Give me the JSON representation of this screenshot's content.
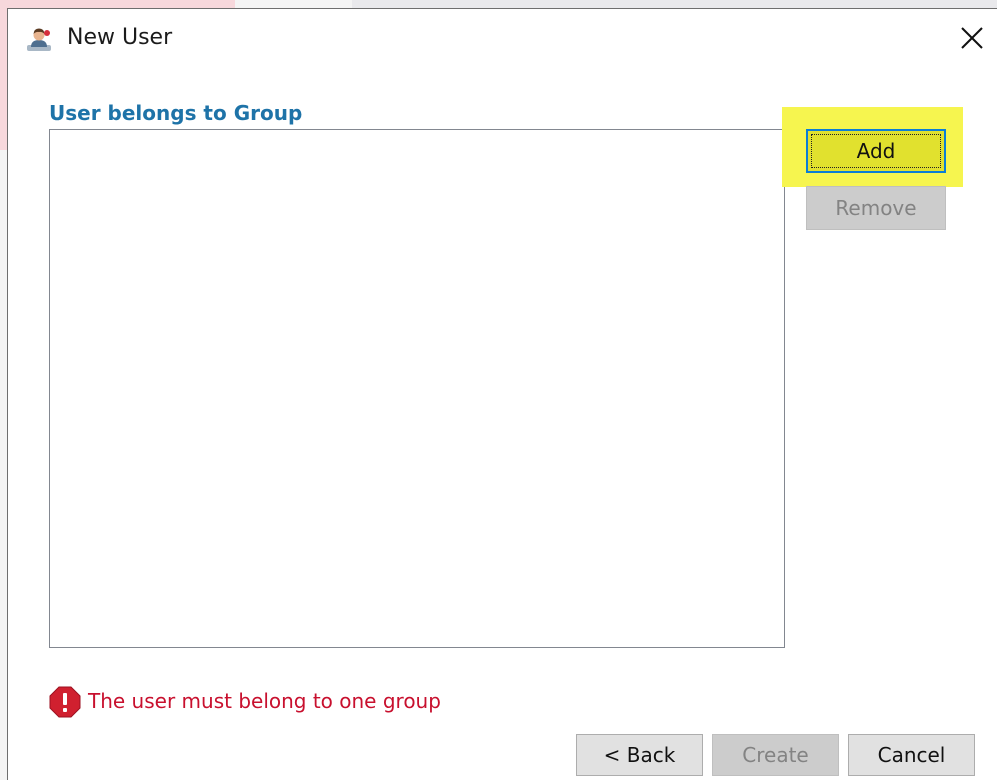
{
  "window": {
    "title": "New User",
    "icon": "user-icon"
  },
  "titlebar": {
    "close_icon": "close-icon"
  },
  "groups": {
    "label": "User belongs to Group",
    "items": []
  },
  "actions": {
    "add_label": "Add",
    "remove_label": "Remove"
  },
  "validation": {
    "icon": "error-icon",
    "message": "The user must belong to one group",
    "color": "#c8102e"
  },
  "footer": {
    "back_label": "< Back",
    "create_label": "Create",
    "cancel_label": "Cancel"
  },
  "colors": {
    "section_label": "#1e73a8",
    "highlight": "#f6f54f",
    "focus_border": "#0b7ed6"
  }
}
